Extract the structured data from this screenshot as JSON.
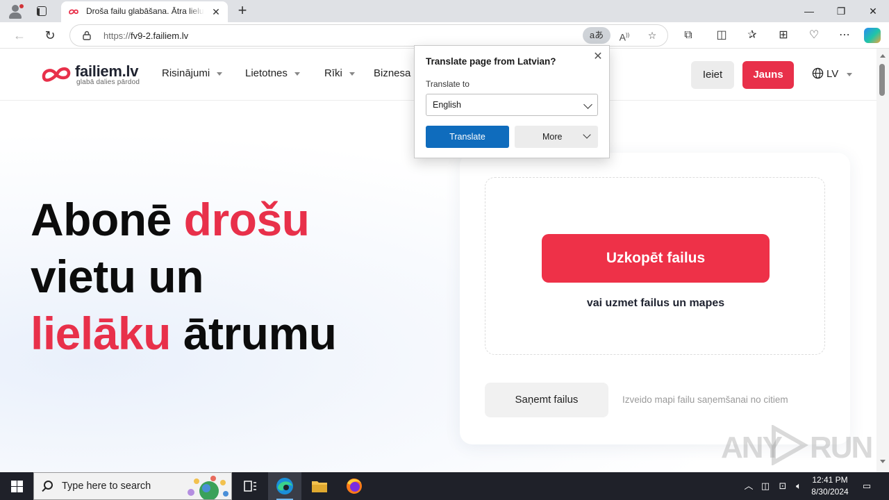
{
  "browser": {
    "tab_title": "Droša failu glabāšana. Ātra lielu failu",
    "url_protocol": "https://",
    "url_host": "fv9-2.failiem.lv",
    "translate_pill_glyph": "aあ",
    "window_controls": {
      "minimize": "—",
      "restore": "❐",
      "close": "✕"
    }
  },
  "site": {
    "brand_name": "failiem.lv",
    "brand_tagline": "glabā dalies pārdod",
    "brand_color": "#e8304a",
    "menu": [
      {
        "label": "Risinājumi"
      },
      {
        "label": "Lietotnes"
      },
      {
        "label": "Rīki"
      },
      {
        "label": "Biznesa"
      }
    ],
    "login_label": "Ieiet",
    "signup_label": "Jauns",
    "language": "LV"
  },
  "hero": {
    "line1_a": "Abonē ",
    "line1_b": "drošu",
    "line2": "vietu un",
    "line3_a": "lielāku",
    "line3_b": " ātrumu"
  },
  "upload": {
    "upload_button": "Uzkopēt failus",
    "drop_hint": "vai uzmet failus un mapes",
    "receive_button": "Saņemt failus",
    "receive_hint": "Izveido mapi failu saņemšanai no citiem"
  },
  "translate_popup": {
    "title": "Translate page from Latvian?",
    "to_label": "Translate to",
    "selected_language": "English",
    "translate_button": "Translate",
    "more_button": "More"
  },
  "watermark": {
    "left": "ANY",
    "right": "RUN"
  },
  "taskbar": {
    "search_placeholder": "Type here to search",
    "time": "12:41 PM",
    "date": "8/30/2024"
  }
}
